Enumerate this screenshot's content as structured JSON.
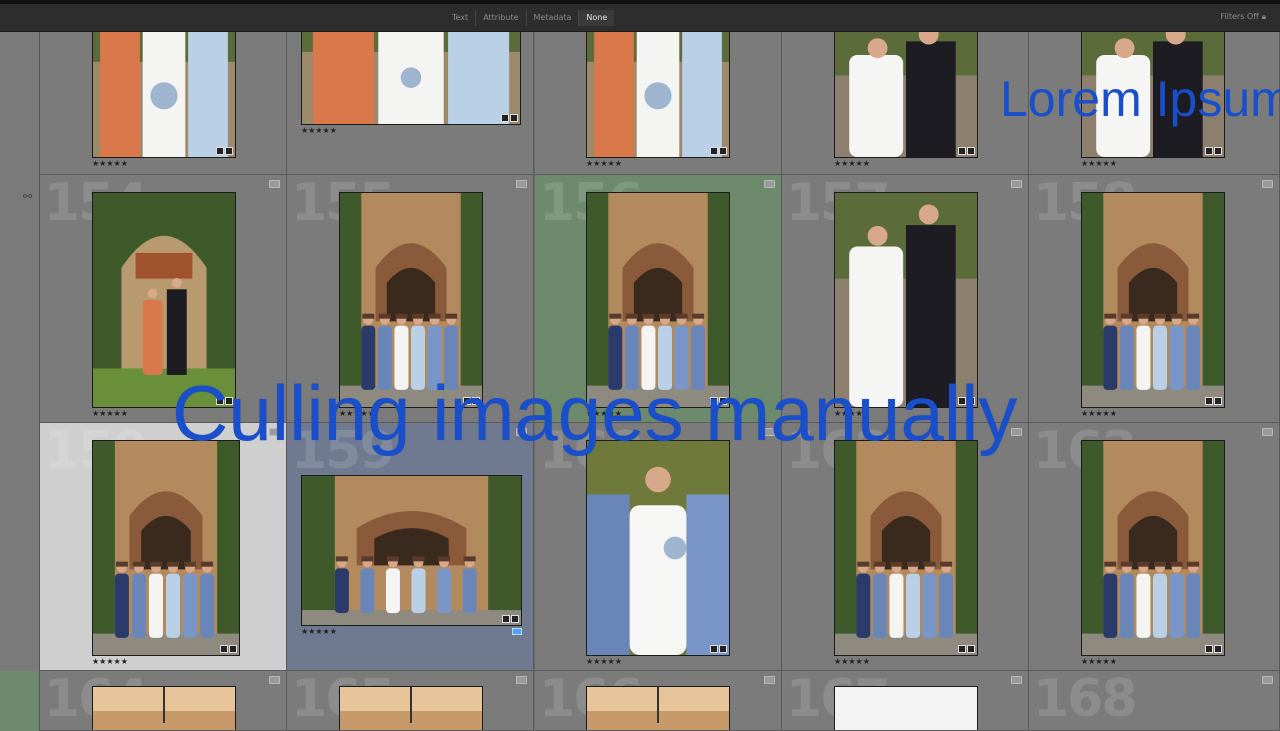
{
  "toolbar": {
    "tabs": [
      {
        "label": "Text",
        "active": false
      },
      {
        "label": "Attribute",
        "active": false
      },
      {
        "label": "Metadata",
        "active": false
      },
      {
        "label": "None",
        "active": true
      }
    ],
    "filters_label": "Filters Off",
    "lock_icon": "lock-icon"
  },
  "overlay": {
    "title": "Culling images manually",
    "lorem": "Lorem Ipsum",
    "color": "#1a4fcc"
  },
  "grid": {
    "rows": [
      {
        "cells": [
          {
            "number": "",
            "stars": "★★★★★",
            "selected": "none",
            "photo": "bridesmaids-close"
          },
          {
            "number": "",
            "stars": "★★★★★",
            "selected": "none",
            "photo": "bridesmaids-close"
          },
          {
            "number": "",
            "stars": "★★★★★",
            "selected": "none",
            "photo": "bridesmaids-close"
          },
          {
            "number": "",
            "stars": "★★★★★",
            "selected": "none",
            "photo": "couple-close"
          },
          {
            "number": "",
            "stars": "★★★★★",
            "selected": "none",
            "photo": "couple-close"
          }
        ]
      },
      {
        "cells": [
          {
            "number": "154",
            "stars": "★★★★★",
            "selected": "none",
            "photo": "arch-couple"
          },
          {
            "number": "155",
            "stars": "★★★★★",
            "selected": "none",
            "photo": "door-group"
          },
          {
            "number": "156",
            "stars": "★★★★★",
            "selected": "green",
            "photo": "door-group"
          },
          {
            "number": "157",
            "stars": "★★★★★",
            "selected": "none",
            "photo": "couple-close"
          },
          {
            "number": "158",
            "stars": "★★★★★",
            "selected": "none",
            "photo": "door-group"
          }
        ]
      },
      {
        "cells": [
          {
            "number": "159",
            "stars": "★★★★★",
            "selected": "white",
            "photo": "door-group"
          },
          {
            "number": "159",
            "stars": "★★★★★",
            "selected": "blue",
            "photo": "group-land"
          },
          {
            "number": "160",
            "stars": "★★★★★",
            "selected": "none",
            "photo": "bride-close"
          },
          {
            "number": "162",
            "stars": "★★★★★",
            "selected": "none",
            "photo": "door-group"
          },
          {
            "number": "163",
            "stars": "★★★★★",
            "selected": "none",
            "photo": "door-group"
          }
        ]
      },
      {
        "cells": [
          {
            "number": "164",
            "stars": "",
            "selected": "none",
            "photo": "interior"
          },
          {
            "number": "165",
            "stars": "",
            "selected": "none",
            "photo": "interior"
          },
          {
            "number": "166",
            "stars": "",
            "selected": "none",
            "photo": "interior"
          },
          {
            "number": "167",
            "stars": "",
            "selected": "none",
            "photo": "white"
          },
          {
            "number": "168",
            "stars": "",
            "selected": "none",
            "photo": "none"
          }
        ]
      }
    ]
  }
}
